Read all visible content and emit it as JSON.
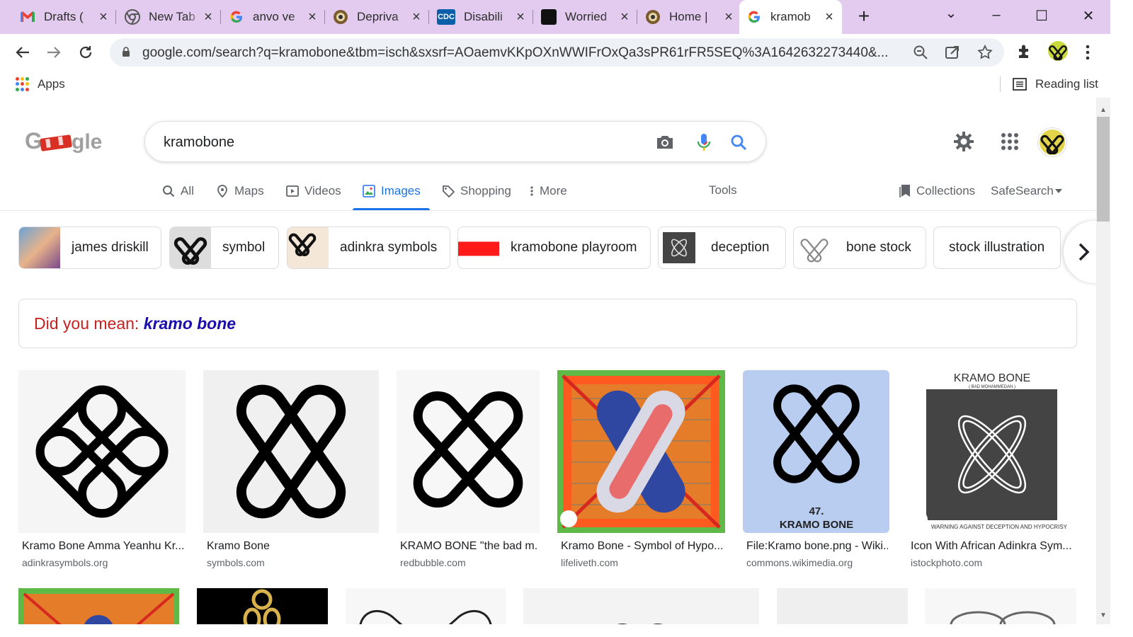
{
  "browser": {
    "tabs": [
      {
        "title": "Drafts (",
        "favicon": "gmail-icon"
      },
      {
        "title": "New Tab",
        "favicon": "chrome-icon"
      },
      {
        "title": "anvo ve",
        "favicon": "google-icon"
      },
      {
        "title": "Depriva",
        "favicon": "seal-icon"
      },
      {
        "title": "Disabili",
        "favicon": "cdc-icon"
      },
      {
        "title": "Worried",
        "favicon": "discover-icon"
      },
      {
        "title": "Home |",
        "favicon": "seal-icon"
      },
      {
        "title": "kramob",
        "favicon": "google-icon",
        "active": true
      }
    ],
    "new_tab": "+",
    "url": "google.com/search?q=kramobone&tbm=isch&sxsrf=AOaemvKKpOXnWWIFrOxQa3sPR61rFR5SEQ%3A1642632273440&...",
    "bookmarks": {
      "apps": "Apps",
      "reading_list": "Reading list"
    },
    "window_controls": {
      "minimize": "–",
      "maximize": "☐",
      "close": "✕",
      "tab_search": "⌄"
    }
  },
  "search": {
    "query": "kramobone",
    "tabs": {
      "all": "All",
      "maps": "Maps",
      "videos": "Videos",
      "images": "Images",
      "shopping": "Shopping",
      "more": "More"
    },
    "tools": "Tools",
    "collections": "Collections",
    "safesearch": "SafeSearch"
  },
  "chips": [
    "james driskill",
    "symbol",
    "adinkra symbols",
    "kramobone playroom",
    "deception",
    "bone stock",
    "stock illustration"
  ],
  "did_you_mean": {
    "prefix": "Did you mean:",
    "suggestion": "kramo bone"
  },
  "results": [
    {
      "title": "Kramo Bone Amma Yeanhu Kr...",
      "source": "adinkrasymbols.org"
    },
    {
      "title": "Kramo Bone",
      "source": "symbols.com"
    },
    {
      "title": "KRAMO BONE \"the bad m...",
      "source": "redbubble.com"
    },
    {
      "title": "Kramo Bone - Symbol of Hypo...",
      "source": "lifeliveth.com"
    },
    {
      "title": "File:Kramo bone.png - Wiki...",
      "source": "commons.wikimedia.org"
    },
    {
      "title": "Icon With African Adinkra Sym...",
      "source": "istockphoto.com"
    }
  ],
  "image_text": {
    "wiki_number": "47.",
    "wiki_caption": "KRAMO BONE",
    "istock_heading": "KRAMO BONE",
    "istock_sub": "( BAD MOHAMMEDAN )",
    "istock_footer": "WARNING AGAINST DECEPTION AND HYPOCRISY"
  },
  "colors": {
    "accent": "#1a73e8",
    "tabstrip": "#e3cbf0",
    "link": "#1a0dab",
    "dym_red": "#c5221f"
  }
}
